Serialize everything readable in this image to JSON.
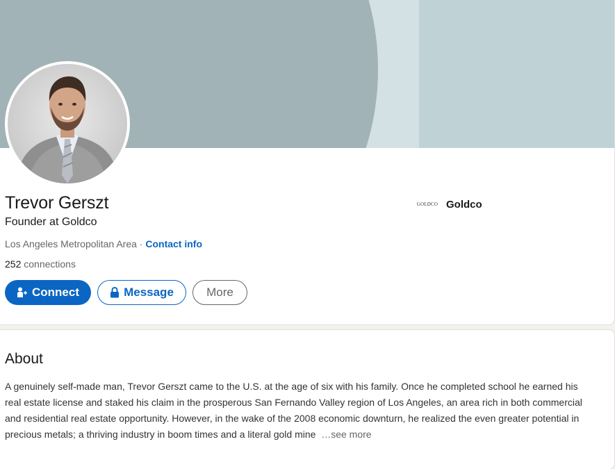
{
  "profile": {
    "name": "Trevor Gerszt",
    "headline": "Founder at Goldco",
    "location": "Los Angeles Metropolitan Area",
    "separator": " · ",
    "contact_info": "Contact info",
    "connections_count": "252",
    "connections_label": " connections"
  },
  "actions": {
    "connect_label": "Connect",
    "message_label": "Message",
    "more_label": "More"
  },
  "company": {
    "logo_text": "GOLDCO",
    "name": "Goldco"
  },
  "about": {
    "title": "About",
    "text": "A genuinely self-made man, Trevor Gerszt came to the U.S. at the age of six with his family. Once he completed school he earned his real estate license and staked his claim in the prosperous San Fernando Valley region of Los Angeles, an area rich in both commercial and residential real estate opportunity. However, in the wake of the 2008 economic downturn, he realized the even greater potential in precious metals; a thriving industry in boom times and a literal gold mine",
    "see_more": "…see more"
  },
  "colors": {
    "accent": "#0a66c2",
    "banner_light": "#d3e1e4",
    "banner_dark": "#a1b3b7"
  }
}
